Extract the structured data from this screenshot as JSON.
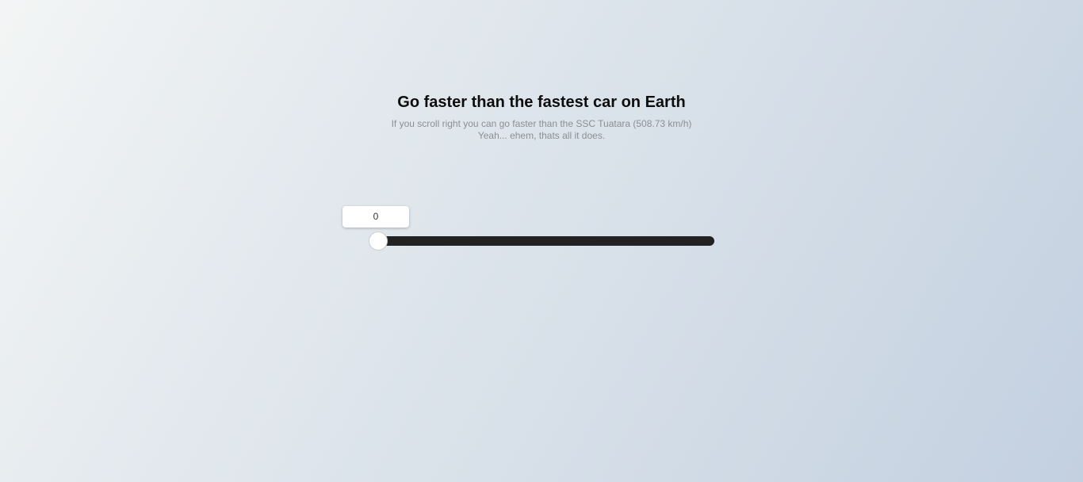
{
  "header": {
    "title": "Go faster than the fastest car on Earth",
    "subtitle_line1": "If you scroll right you can go faster than the SSC Tuatara (508.73 km/h)",
    "subtitle_line2": "Yeah... ehem, thats all it does."
  },
  "slider": {
    "value": "0",
    "fraction": 0,
    "track_color": "#222222"
  }
}
